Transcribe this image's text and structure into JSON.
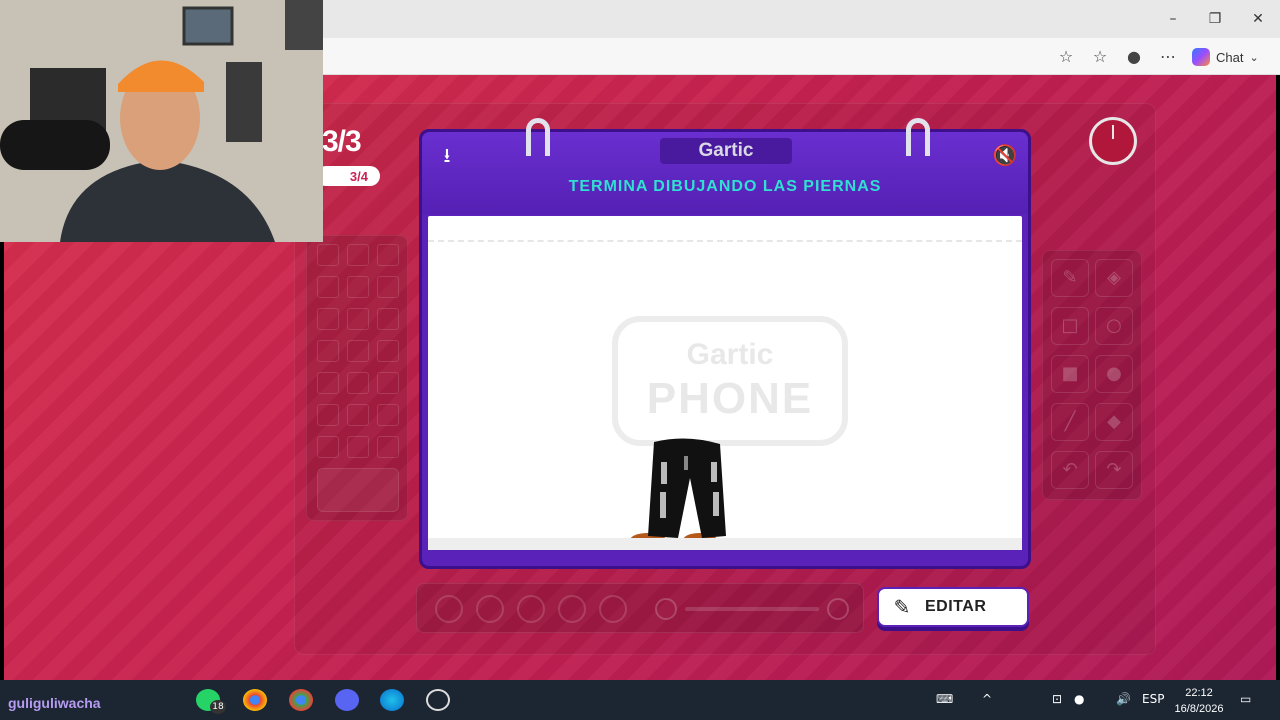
{
  "browser": {
    "window_controls": {
      "minimize": "–",
      "maximize": "❐",
      "close": "✕"
    },
    "toolbar": {
      "chat_label": "Chat"
    }
  },
  "game": {
    "round": "3/3",
    "subround": "3/4",
    "logo": "Gartic",
    "instruction": "TERMINA DIBUJANDO LAS PIERNAS",
    "watermark": {
      "line1": "Gartic",
      "line2": "PHONE"
    },
    "edit_button_label": "EDITAR",
    "colors": {
      "background": "#d02a4d",
      "notebook": "#5a22b8",
      "instruction_text": "#30e0d0"
    }
  },
  "taskbar": {
    "username": "guliguliwacha",
    "whatsapp_badge": "18",
    "language": "ESP",
    "time": "22:12",
    "date": "16/8/2026"
  }
}
